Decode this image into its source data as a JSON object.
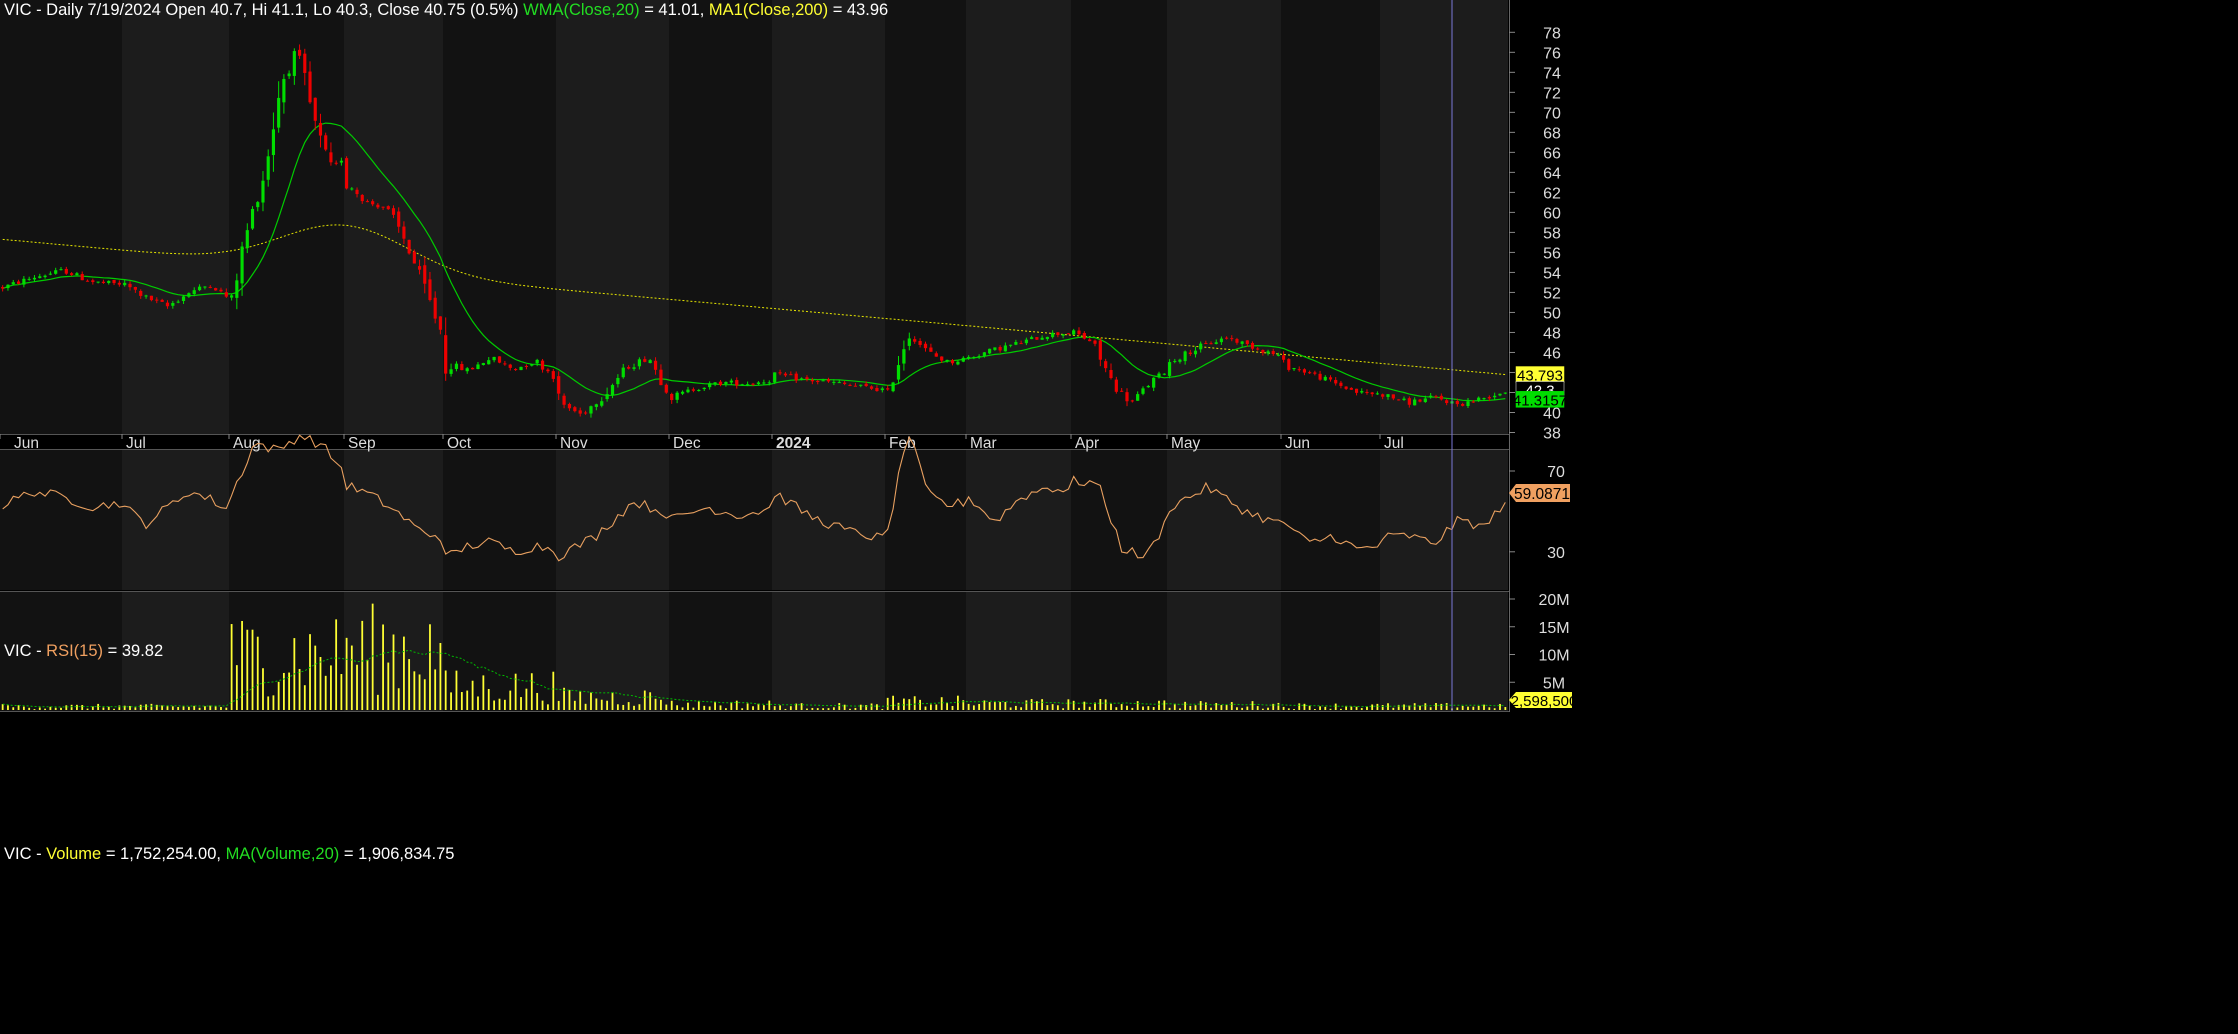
{
  "symbol": "VIC",
  "colors": {
    "background": "#000000",
    "panel_band_a": "#121212",
    "panel_band_b": "#1c1c1c",
    "up_candle": "#00dd00",
    "down_candle": "#ee0000",
    "wma": "#00cc00",
    "ma200": "#e6e600",
    "rsi": "#e8a060",
    "volume": "#ffff33",
    "volume_ma": "#00bb00",
    "cursor_line": "#7a78d8",
    "text": "#ffffff",
    "axis_text": "#dddddd"
  },
  "price_panel": {
    "header": {
      "prefix": "VIC - Daily 7/19/2024 Open 40.7, Hi 41.1, Lo 40.3, Close 40.75 (0.5%)",
      "wma_label": "WMA(Close,20)",
      "wma_value": "= 41.01,",
      "ma_label": "MA1(Close,200)",
      "ma_value": "= 43.96"
    },
    "y_ticks": [
      38,
      40,
      42,
      44,
      46,
      48,
      50,
      52,
      54,
      56,
      58,
      60,
      62,
      64,
      66,
      68,
      70,
      72,
      74,
      76,
      78
    ],
    "tags": [
      {
        "label": "43.793",
        "value": 43.793,
        "bg": "#ffff33",
        "fg": "#000000"
      },
      {
        "label": "42.3",
        "value": 42.3,
        "bg": "#000000",
        "fg": "#ffffff"
      },
      {
        "label": "41.3157",
        "value": 41.3157,
        "bg": "#00dd00",
        "fg": "#000000"
      }
    ]
  },
  "x_axis": {
    "labels": [
      "Jun",
      "Jul",
      "Aug",
      "Sep",
      "Oct",
      "Nov",
      "Dec",
      "2024",
      "Feb",
      "Mar",
      "Apr",
      "May",
      "Jun",
      "Jul"
    ]
  },
  "rsi_panel": {
    "header": {
      "prefix": "VIC - ",
      "label": "RSI(15)",
      "value": "= 39.82"
    },
    "y_ticks": [
      30,
      70
    ],
    "tag": {
      "label": "59.0871",
      "value": 59.0871
    }
  },
  "volume_panel": {
    "header": {
      "prefix": "VIC - ",
      "label": "Volume",
      "value": "= 1,752,254.00,",
      "ma_label": "MA(Volume,20)",
      "ma_value": "= 1,906,834.75"
    },
    "y_ticks": [
      "5M",
      "10M",
      "15M",
      "20M"
    ],
    "tag": {
      "label": "2,598,500"
    }
  },
  "chart_data": {
    "type": "candlestick",
    "period": "Daily",
    "months": [
      {
        "label": "Jun",
        "price_knots": [
          52.5,
          53.5,
          54.2,
          53.0,
          52.8
        ],
        "volume_millions": 0.6,
        "rsi_knots": [
          53,
          60,
          57,
          52,
          55
        ]
      },
      {
        "label": "Jul",
        "price_knots": [
          52.8,
          51.5,
          50.6,
          52.0,
          52.8,
          51.2
        ],
        "volume_millions": 0.6,
        "rsi_knots": [
          52,
          44,
          52,
          60,
          56,
          50
        ]
      },
      {
        "label": "Aug",
        "price_knots": [
          51.5,
          58.5,
          64.0,
          73.0,
          76.0,
          69.0,
          64.0,
          66.0
        ],
        "volume_millions": 9.5,
        "rsi_knots": [
          58,
          84,
          80,
          88,
          82,
          68
        ]
      },
      {
        "label": "Sep",
        "price_knots": [
          63.0,
          61.0,
          60.5,
          57.0,
          52.0,
          47.0
        ],
        "volume_millions": 10.5,
        "rsi_knots": [
          63,
          58,
          50,
          40,
          37
        ]
      },
      {
        "label": "Oct",
        "price_knots": [
          45.0,
          44.2,
          45.5,
          44.3,
          45.2,
          43.2
        ],
        "volume_millions": 4.0,
        "rsi_knots": [
          27,
          33,
          35,
          30,
          33,
          31
        ]
      },
      {
        "label": "Nov",
        "price_knots": [
          41.0,
          39.8,
          41.8,
          44.5,
          45.5,
          41.3
        ],
        "volume_millions": 2.2,
        "rsi_knots": [
          28,
          38,
          55,
          48
        ]
      },
      {
        "label": "Dec",
        "price_knots": [
          41.5,
          42.5,
          43.0,
          42.9,
          43.3
        ],
        "volume_millions": 1.0,
        "rsi_knots": [
          46,
          52,
          48,
          52
        ]
      },
      {
        "label": "2024",
        "price_knots": [
          43.8,
          43.3,
          43.0,
          42.6,
          42.2
        ],
        "volume_millions": 0.7,
        "rsi_knots": [
          59,
          47,
          40,
          36
        ]
      },
      {
        "label": "Feb",
        "price_knots": [
          42.0,
          48.0,
          46.0,
          45.0,
          45.5
        ],
        "volume_millions": 1.4,
        "rsi_knots": [
          40,
          90,
          58,
          53,
          55
        ]
      },
      {
        "label": "Mar",
        "price_knots": [
          45.5,
          46.3,
          47.0,
          47.8,
          48.0
        ],
        "volume_millions": 1.1,
        "rsi_knots": [
          57,
          45,
          57,
          62,
          60
        ]
      },
      {
        "label": "Apr",
        "price_knots": [
          48.0,
          47.0,
          43.0,
          41.0,
          43.0,
          44.5
        ],
        "volume_millions": 1.1,
        "rsi_knots": [
          65,
          64,
          32,
          27,
          48
        ]
      },
      {
        "label": "May",
        "price_knots": [
          45.0,
          46.5,
          47.5,
          46.5,
          45.5
        ],
        "volume_millions": 0.9,
        "rsi_knots": [
          52,
          62,
          50,
          43
        ]
      },
      {
        "label": "Jun",
        "price_knots": [
          44.8,
          44.0,
          43.0,
          42.0,
          41.8
        ],
        "volume_millions": 0.7,
        "rsi_knots": [
          45,
          34,
          38,
          31,
          33
        ]
      },
      {
        "label": "Jul",
        "price_knots": [
          41.8,
          41.0,
          41.5,
          40.8,
          41.5,
          42.3
        ],
        "volume_millions": 0.7,
        "rsi_knots": [
          37,
          38,
          34,
          46,
          42,
          59
        ]
      }
    ],
    "indicators": {
      "wma_close_20": {
        "last": 41.3157
      },
      "ma_close_200": {
        "last": 43.793,
        "first": 57.3
      }
    },
    "y_range": {
      "price": [
        38,
        78
      ],
      "rsi": [
        20,
        100
      ],
      "volume_millions": [
        0,
        20
      ]
    }
  }
}
